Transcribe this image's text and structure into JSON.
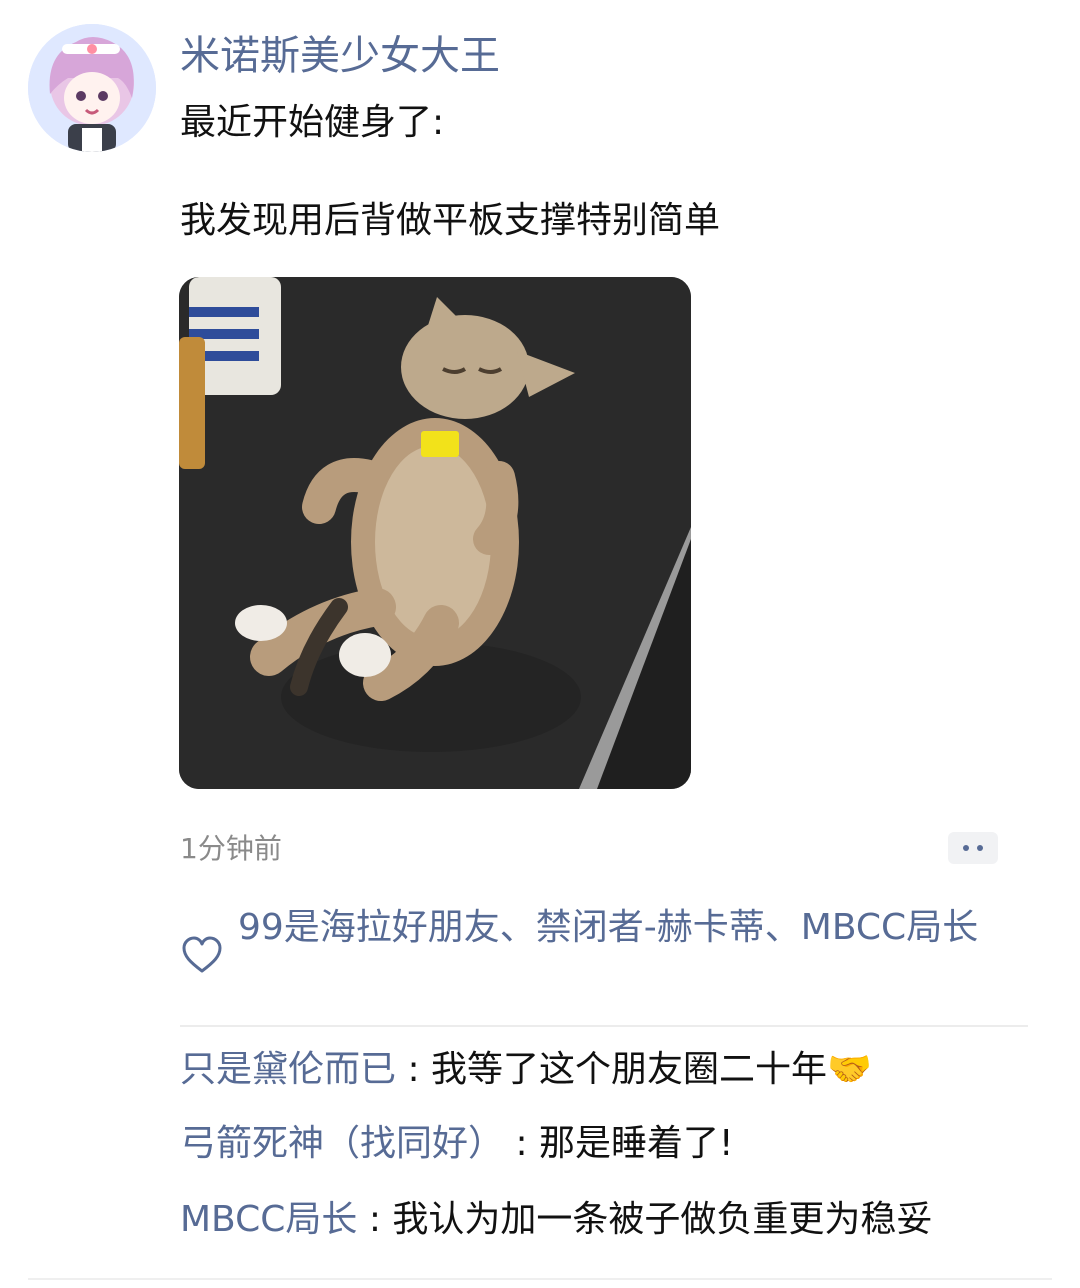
{
  "post": {
    "username": "米诺斯美少女大王",
    "line1": "最近开始健身了:",
    "line2": "我发现用后背做平板支撑特别简单",
    "timestamp": "1分钟前"
  },
  "likes": {
    "names": "99是海拉好朋友、禁闭者-赫卡蒂、MBCC局长"
  },
  "comments": [
    {
      "name": "只是黛伦而已",
      "sep": " : ",
      "text": "我等了这个朋友圈二十年",
      "emoji": "🤝"
    },
    {
      "name": "弓箭死神（找同好）",
      "sep": " : ",
      "text": "那是睡着了!"
    },
    {
      "name": "MBCC局长",
      "sep": " : ",
      "text": "我认为加一条被子做负重更为稳妥"
    }
  ],
  "colors": {
    "link": "#576b95",
    "text": "#111111",
    "muted": "#8a8a8a"
  },
  "icons": {
    "like": "heart-icon",
    "more": "more-icon"
  }
}
